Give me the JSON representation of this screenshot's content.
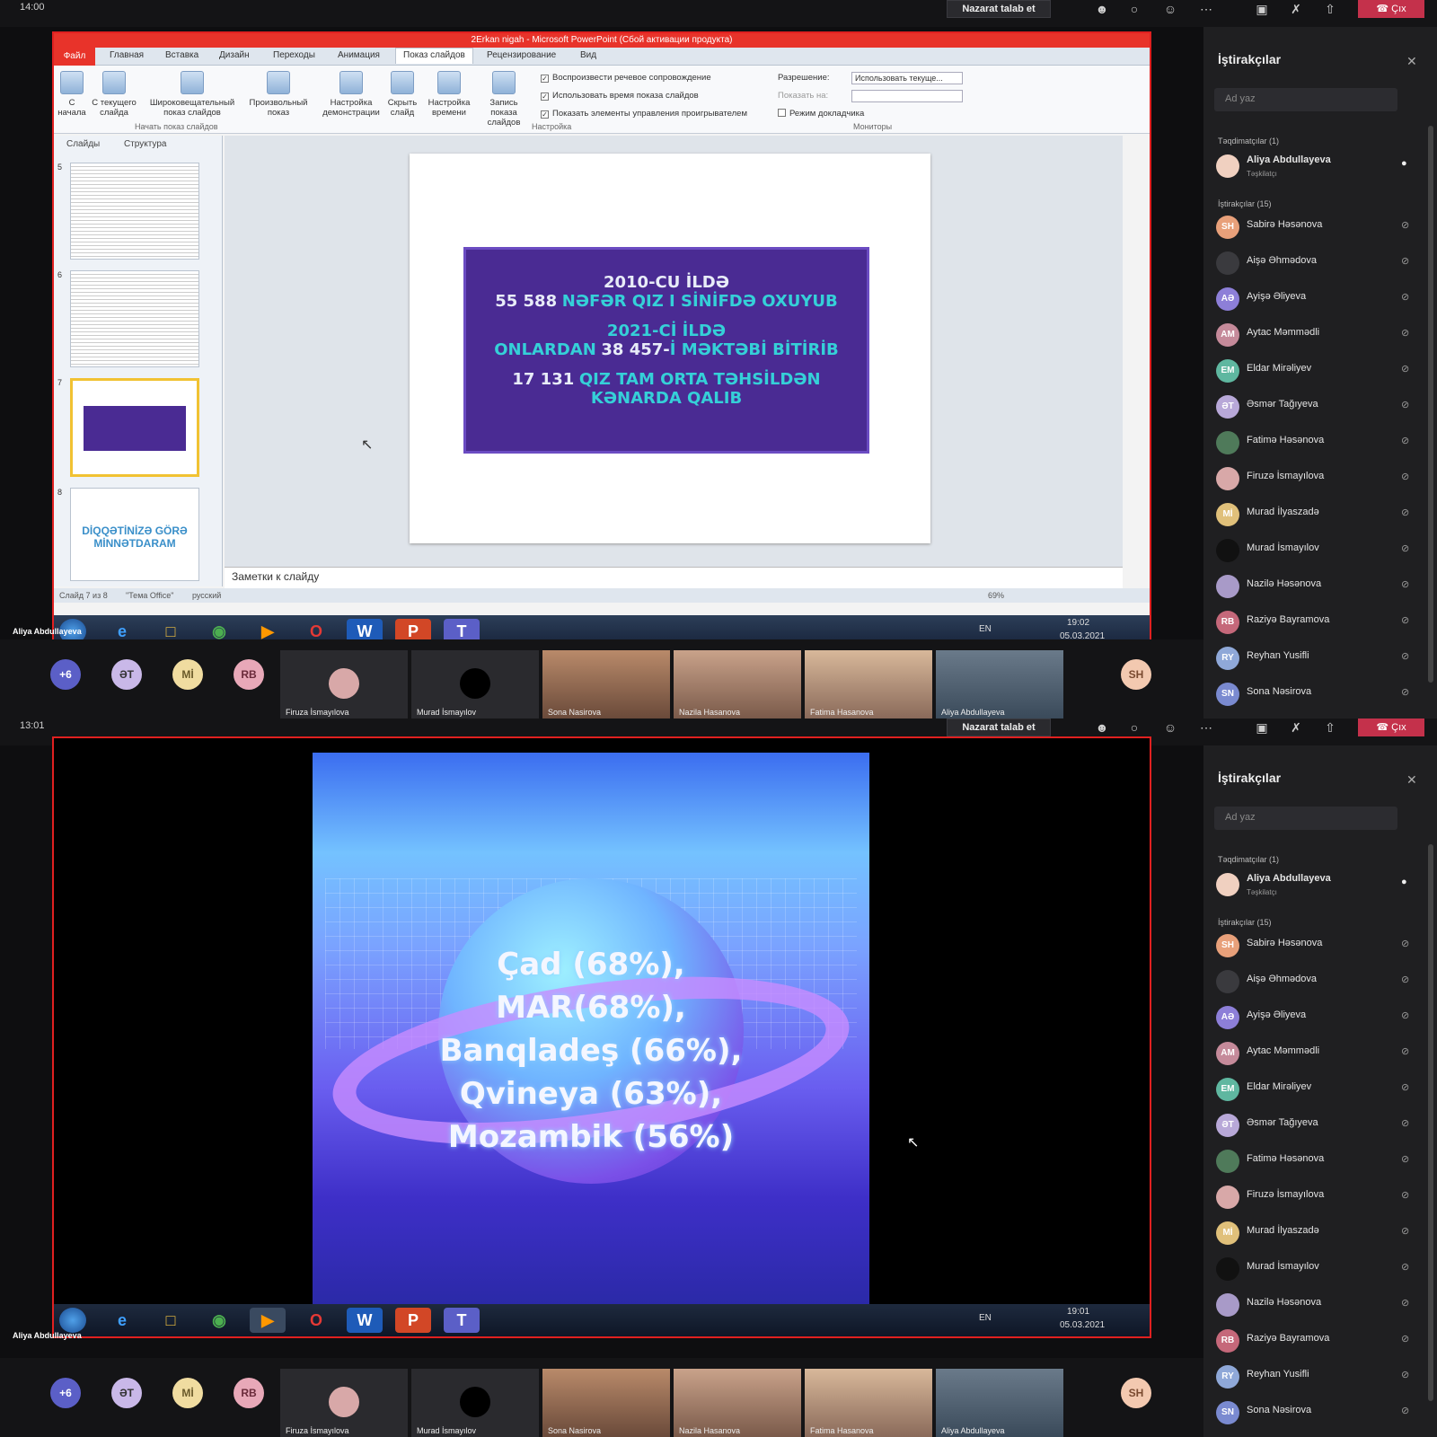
{
  "panels": [
    {
      "clock": "14:00"
    },
    {
      "clock": "13:01"
    }
  ],
  "topbar": {
    "request_control": "Nazarat talab et",
    "leave": "Çıx",
    "icons": [
      "participants-icon",
      "chat-icon",
      "reactions-icon",
      "more-icon",
      "camera-off-icon",
      "mic-off-icon",
      "share-icon",
      "phone-hangup-icon"
    ]
  },
  "ppt": {
    "title": "2Erkan nigah - Microsoft PowerPoint (Сбой активации продукта)",
    "tabs": [
      "Файл",
      "Главная",
      "Вставка",
      "Дизайн",
      "Переходы",
      "Анимация",
      "Показ слайдов",
      "Рецензирование",
      "Вид"
    ],
    "active_tab": "Показ слайдов",
    "ribbon_buttons": [
      {
        "label": "С начала"
      },
      {
        "label": "С текущего слайда"
      },
      {
        "label": "Широковещательный показ слайдов"
      },
      {
        "label": "Произвольный показ"
      },
      {
        "label": "Настройка демонстрации"
      },
      {
        "label": "Скрыть слайд"
      },
      {
        "label": "Настройка времени"
      },
      {
        "label": "Запись показа слайдов"
      }
    ],
    "groups": {
      "start": "Начать показ слайдов",
      "setup": "Настройка",
      "monitors": "Мониторы"
    },
    "checks": [
      {
        "label": "Воспроизвести речевое сопровождение",
        "checked": true
      },
      {
        "label": "Использовать время показа слайдов",
        "checked": true
      },
      {
        "label": "Показать элементы управления проигрывателем",
        "checked": true
      }
    ],
    "resolution_label": "Разрешение:",
    "resolution_value": "Использовать текуще...",
    "show_on_label": "Показать на:",
    "presenter_view": "Режим докладчика",
    "thumb_tabs": [
      "Слайды",
      "Структура"
    ],
    "thumb_numbers": [
      "5",
      "6",
      "7",
      "8"
    ],
    "thumb8_text": "DİQQƏTİNİZƏ GÖRƏ MİNNƏTDARAM",
    "slide": {
      "l1": "2010-CU İLDƏ",
      "l2a": "55 588",
      "l2b": "NƏFƏR QIZ I SİNİFDƏ OXUYUB",
      "l3": "2021-Cİ İLDƏ",
      "l4a": "ONLARDAN",
      "l4b": "38 457-",
      "l4c": "İ MƏKTƏBİ BİTİRİB",
      "l5a": "17 131",
      "l5b": "QIZ TAM ORTA TƏHSİLDƏN",
      "l6": "KƏNARDA QALIB"
    },
    "notes": "Заметки к слайду",
    "status_slide": "Слайд 7 из 8",
    "status_theme": "\"Тема Office\"",
    "status_lang": "русский",
    "zoom": "69%"
  },
  "video_slide": {
    "lines": [
      "Çad (68%),",
      "MAR(68%),",
      "Banqladeş (66%),",
      "Qvineya (63%),",
      "Mozambik (56%)"
    ]
  },
  "taskbar": {
    "presenter_label": "Aliya Abdullayeva",
    "lang": "EN",
    "time1": "19:02",
    "date1": "05.03.2021",
    "time2": "19:01",
    "date2": "05.03.2021"
  },
  "participants_panel": {
    "title": "İştirakçılar",
    "search_placeholder": "Ad yaz",
    "presenters_header": "Təqdimatçılar (1)",
    "presenter": {
      "name": "Aliya Abdullayeva",
      "role": "Təşkilatçı"
    },
    "attendees_header": "İştirakçılar (15)",
    "attendees": [
      {
        "initials": "SH",
        "name": "Sabirə Həsənova",
        "color": "#e8a07a"
      },
      {
        "initials": "",
        "name": "Aişə Əhmədova",
        "color": "#3a3a3e"
      },
      {
        "initials": "AƏ",
        "name": "Ayişə Əliyeva",
        "color": "#8d7fd8"
      },
      {
        "initials": "AM",
        "name": "Aytac Məmmədli",
        "color": "#c58a9a"
      },
      {
        "initials": "EM",
        "name": "Eldar Mirəliyev",
        "color": "#5fb7a0"
      },
      {
        "initials": "ƏT",
        "name": "Əsmər Tağıyeva",
        "color": "#b8a8d8"
      },
      {
        "initials": "",
        "name": "Fatimə Həsənova",
        "color": "#4f7a5a"
      },
      {
        "initials": "",
        "name": "Firuzə İsmayılova",
        "color": "#d8a8a8"
      },
      {
        "initials": "Mİ",
        "name": "Murad İlyaszadə",
        "color": "#e0c07a"
      },
      {
        "initials": "",
        "name": "Murad İsmayılov",
        "color": "#111"
      },
      {
        "initials": "",
        "name": "Nazilə Həsənova",
        "color": "#a89ac8"
      },
      {
        "initials": "RB",
        "name": "Raziyə Bayramova",
        "color": "#c5687a"
      },
      {
        "initials": "RY",
        "name": "Reyhan Yusifli",
        "color": "#8fa8d8"
      },
      {
        "initials": "SN",
        "name": "Sona Nəsirova",
        "color": "#7a8ad0"
      }
    ]
  },
  "gallery": {
    "more_count": "+6",
    "avatars": [
      {
        "initials": "ƏT",
        "color": "#c9b8e8",
        "fg": "#333"
      },
      {
        "initials": "Mİ",
        "color": "#f0dca0",
        "fg": "#6a5a2a"
      },
      {
        "initials": "RB",
        "color": "#e8a8b8",
        "fg": "#6a2a3a"
      }
    ],
    "tiles": [
      {
        "name": "Firuza İsmayılova"
      },
      {
        "name": "Murad İsmayılov"
      },
      {
        "name": "Sona Nasirova"
      },
      {
        "name": "Nazila Hasanova"
      },
      {
        "name": "Fatima Hasanova"
      },
      {
        "name": "Aliya Abdullayeva"
      }
    ],
    "sh": "SH"
  }
}
